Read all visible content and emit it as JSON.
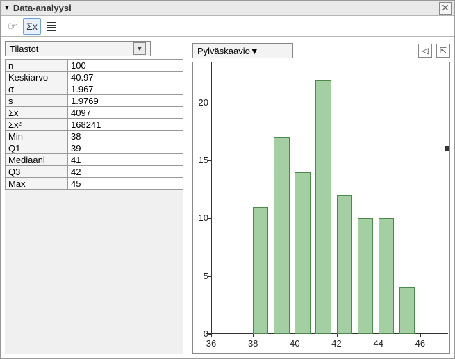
{
  "titlebar": {
    "title": "Data-analyysi"
  },
  "toolbar": {
    "hand_tooltip": "hand",
    "sigma_label": "Σx",
    "stack_tooltip": "stack"
  },
  "left": {
    "dropdown_label": "Tilastot",
    "stats": [
      {
        "name": "n",
        "value": "100"
      },
      {
        "name": "Keskiarvo",
        "value": "40.97"
      },
      {
        "name": "σ",
        "value": "1.967"
      },
      {
        "name": "s",
        "value": "1.9769"
      },
      {
        "name": "Σx",
        "value": "4097"
      },
      {
        "name": "Σx²",
        "value": "168241"
      },
      {
        "name": "Min",
        "value": "38"
      },
      {
        "name": "Q1",
        "value": "39"
      },
      {
        "name": "Mediaani",
        "value": "41"
      },
      {
        "name": "Q3",
        "value": "42"
      },
      {
        "name": "Max",
        "value": "45"
      }
    ]
  },
  "right": {
    "dropdown_label": "Pylväskaavio",
    "back_icon": "◁",
    "popout_icon": "⇱"
  },
  "chart_data": {
    "type": "bar",
    "categories": [
      38,
      39,
      40,
      41,
      42,
      43,
      44,
      45
    ],
    "values": [
      11,
      17,
      14,
      22,
      12,
      10,
      10,
      4
    ],
    "x_ticks": [
      36,
      38,
      40,
      42,
      44,
      46
    ],
    "y_ticks": [
      0,
      5,
      10,
      15,
      20
    ],
    "xlim": [
      36,
      47
    ],
    "ylim": [
      0,
      23
    ],
    "title": "",
    "xlabel": "",
    "ylabel": ""
  }
}
